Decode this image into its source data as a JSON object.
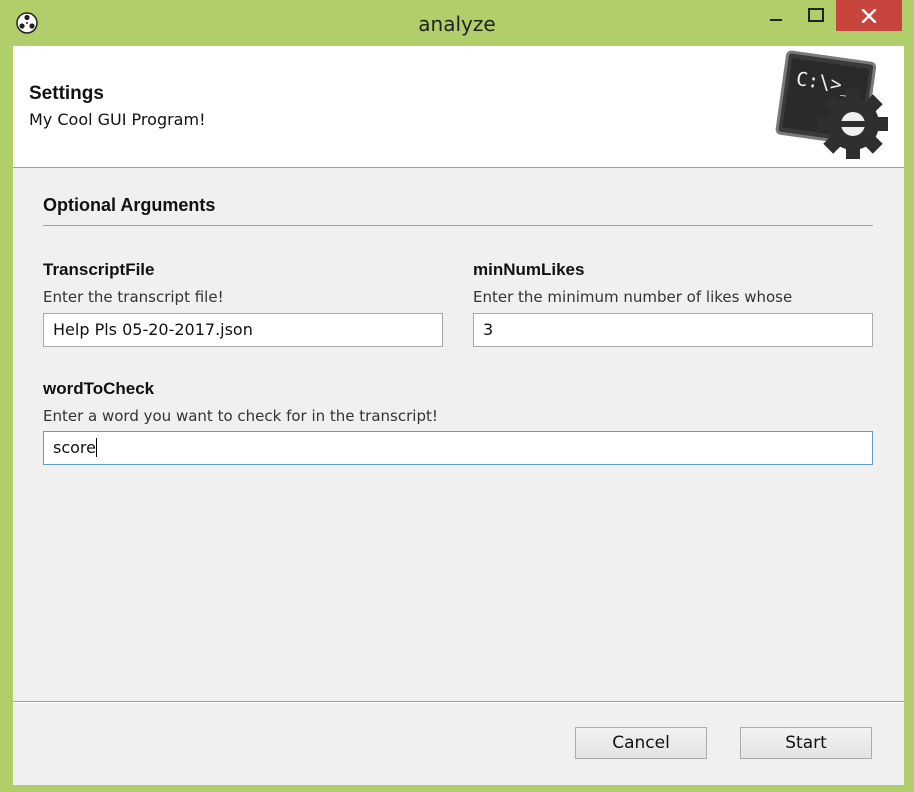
{
  "window": {
    "title": "analyze",
    "accent_color": "#b0ce6a",
    "close_color": "#c7453c"
  },
  "header": {
    "title": "Settings",
    "subtitle": "My Cool GUI Program!",
    "icon_text": "C:\\>_"
  },
  "section": {
    "title": "Optional Arguments"
  },
  "fields": {
    "transcript": {
      "label": "TranscriptFile",
      "help": "Enter the transcript file!",
      "value": "Help Pls 05-20-2017.json"
    },
    "min_likes": {
      "label": "minNumLikes",
      "help": "Enter the minimum number of likes whose",
      "value": "3"
    },
    "word": {
      "label": "wordToCheck",
      "help": "Enter a word you want to check for in the transcript!",
      "value": "score"
    }
  },
  "buttons": {
    "cancel": "Cancel",
    "start": "Start"
  }
}
